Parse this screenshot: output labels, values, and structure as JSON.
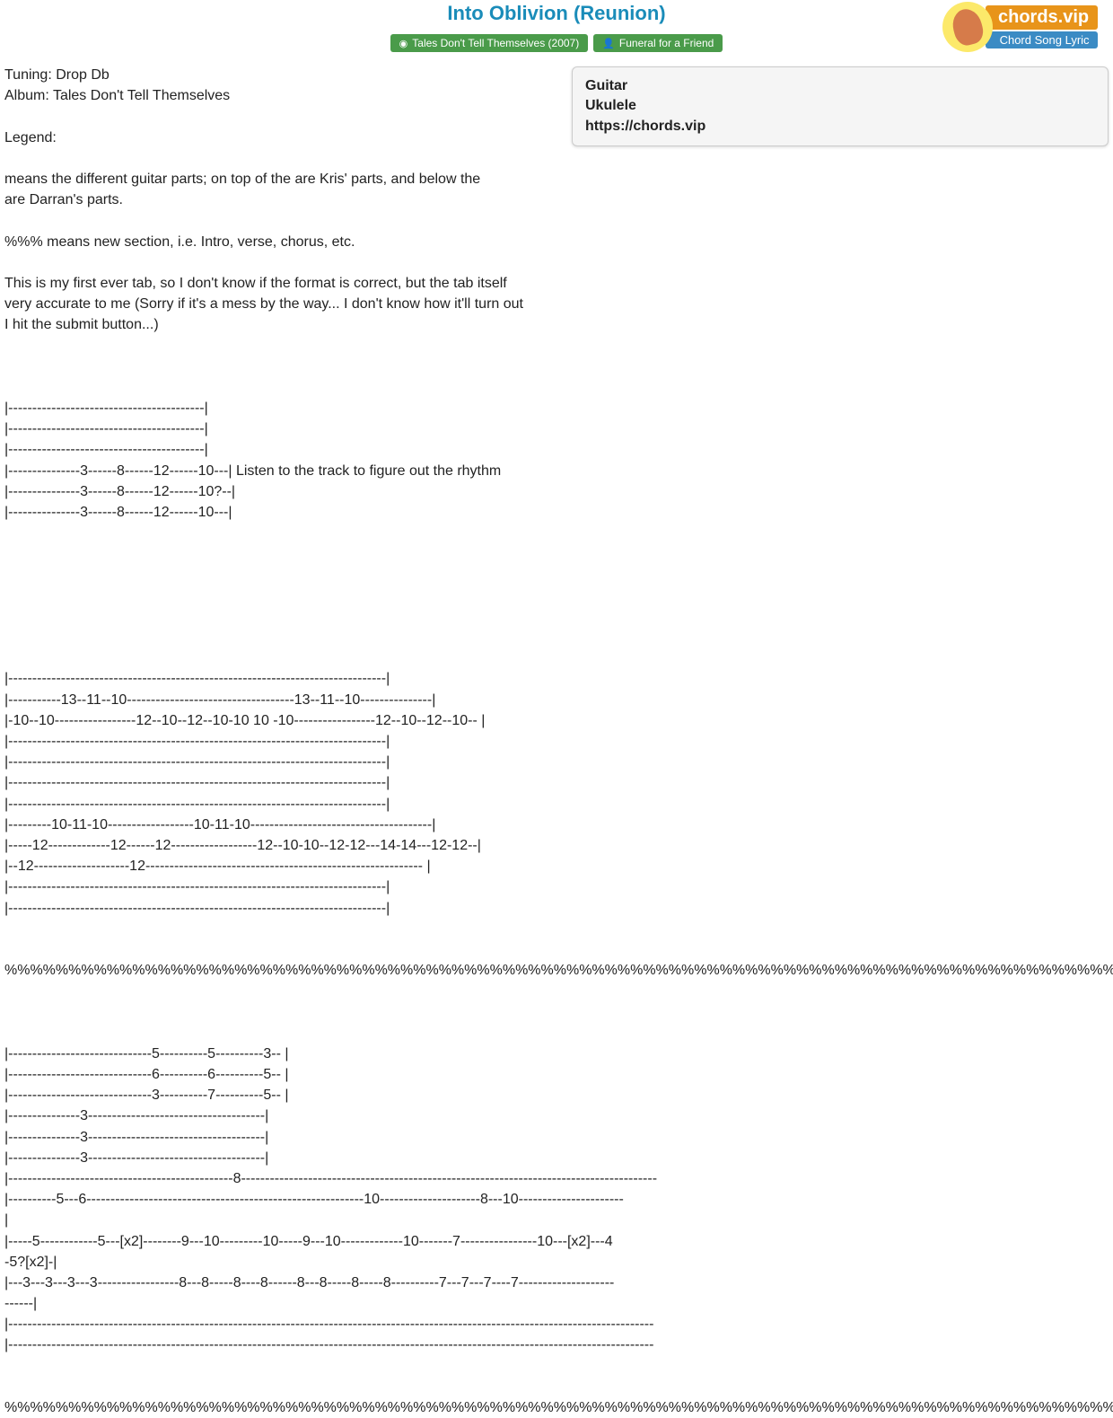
{
  "header": {
    "title": "Into Oblivion (Reunion)",
    "album_tag": "Tales Don't Tell Themselves (2007)",
    "artist_tag": "Funeral for a Friend",
    "logo_brand": "chords.vip",
    "logo_sub": "Chord Song Lyric"
  },
  "sidebar": {
    "items": [
      "Guitar",
      "Ukulele",
      "https://chords.vip"
    ]
  },
  "tab_content": "Tuning: Drop Db\nAlbum: Tales Don't Tell Themselves\n\nLegend:\n\nmeans the different guitar parts; on top of the are Kris' parts, and below the\nare Darran's parts.\n\n%%% means new section, i.e. Intro, verse, chorus, etc.\n\nThis is my first ever tab, so I don't know if the format is correct, but the tab itself\nvery accurate to me (Sorry if it's a mess by the way... I don't know how it'll turn out\nI hit the submit button...)\n\n\n\n|-----------------------------------------|\n|-----------------------------------------|\n|-----------------------------------------|\n|---------------3------8------12------10---| Listen to the track to figure out the rhythm\n|---------------3------8------12------10?--|\n|---------------3------8------12------10---|\n\n\n\n\n\n\n\n|-------------------------------------------------------------------------------|\n|-----------13--11--10-----------------------------------13--11--10---------------|\n|-10--10-----------------12--10--12--10-10 10 -10-----------------12--10--12--10-- |\n|-------------------------------------------------------------------------------|\n|-------------------------------------------------------------------------------|\n|-------------------------------------------------------------------------------|\n|-------------------------------------------------------------------------------|\n|---------10-11-10------------------10-11-10--------------------------------------|\n|-----12-------------12------12------------------12--10-10--12-12---14-14---12-12--|\n|--12--------------------12---------------------------------------------------------- |\n|-------------------------------------------------------------------------------|\n|-------------------------------------------------------------------------------|\n\n\n%%%%%%%%%%%%%%%%%%%%%%%%%%%%%%%%%%%%%%%%%%%%%%%%%%%%%%%%%%%%%%%%%%%%%%%%%%%%%%%%%%%%%%%%%%%%%%%%%%%%%%%%%%%%%\n\n\n\n|------------------------------5----------5----------3-- |\n|------------------------------6----------6----------5-- |\n|------------------------------3----------7----------5-- |\n|---------------3-------------------------------------|\n|---------------3-------------------------------------|\n|---------------3-------------------------------------|\n|-----------------------------------------------8---------------------------------------------------------------------------------------\n|----------5---6----------------------------------------------------------10---------------------8---10----------------------\n|\n|-----5------------5---[x2]--------9---10---------10-----9---10-------------10-------7----------------10---[x2]---4\n-5?[x2]-|\n|---3---3---3---3-----------------8---8-----8----8------8---8-----8-----8----------7---7---7----7--------------------\n------|\n|---------------------------------------------------------------------------------------------------------------------------------------\n|---------------------------------------------------------------------------------------------------------------------------------------\n\n\n%%%%%%%%%%%%%%%%%%%%%%%%%%%%%%%%%%%%%%%%%%%%%%%%%%%%%%%%%%%%%%%%%%%%%%%%%%%%%%%%%%%%%%%%%%%%%%%%%%%%%%%%%%%%%"
}
